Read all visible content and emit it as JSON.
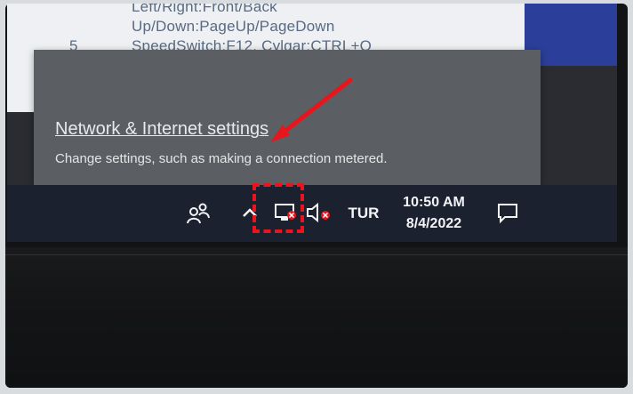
{
  "app_window": {
    "lines": [
      "Left/Right:Front/Back",
      "Up/Down:PageUp/PageDown",
      "SpeedSwitch:F12, Cylgar:CTRL+Q"
    ],
    "row_number": "5"
  },
  "flyout": {
    "link_label": "Network & Internet settings",
    "description": "Change settings, such as making a connection metered."
  },
  "taskbar": {
    "people_icon": "people-icon",
    "chevron_icon": "chevron-up-icon",
    "network_icon": "network-icon",
    "volume_icon": "volume-icon",
    "language": "TUR",
    "time": "10:50 AM",
    "date": "8/4/2022",
    "action_center_icon": "notification-icon"
  },
  "colors": {
    "taskbar": "#1c2130",
    "flyout": "#5b5e62",
    "annotation": "#e8151c"
  }
}
